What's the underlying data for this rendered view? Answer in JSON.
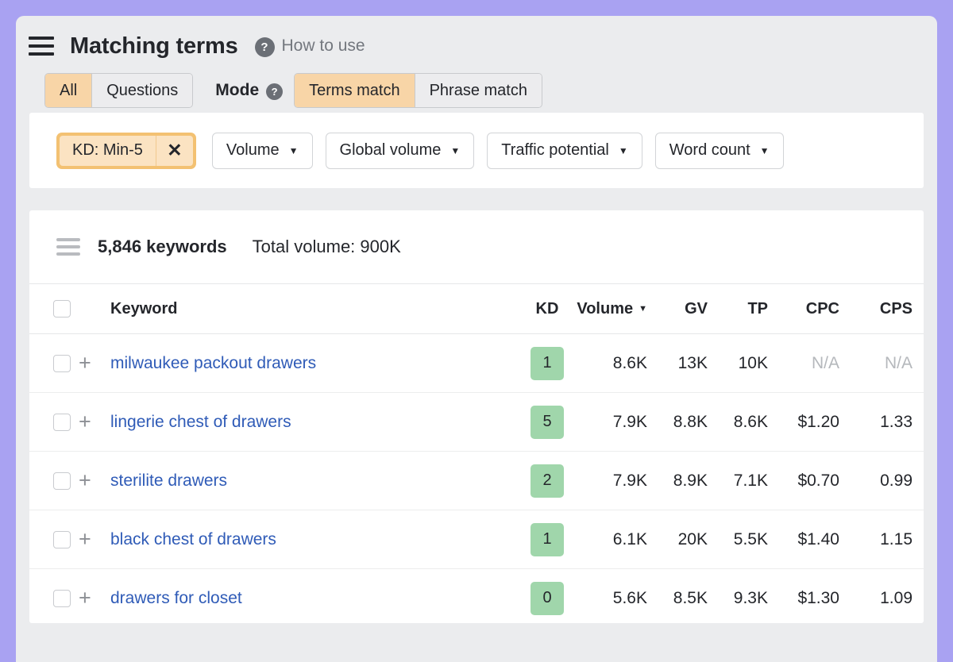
{
  "header": {
    "menu_icon": "hamburger-icon",
    "title": "Matching terms",
    "help_icon": "question-mark-icon",
    "help_label": "How to use"
  },
  "mode_bar": {
    "scope_tabs": [
      {
        "label": "All",
        "active": true
      },
      {
        "label": "Questions",
        "active": false
      }
    ],
    "mode_label": "Mode",
    "mode_help_icon": "question-mark-icon",
    "mode_tabs": [
      {
        "label": "Terms match",
        "active": true
      },
      {
        "label": "Phrase match",
        "active": false
      }
    ]
  },
  "filters": {
    "active_chip": {
      "label": "KD: Min-5",
      "remove_icon": "close-icon"
    },
    "chips": [
      {
        "label": "Volume"
      },
      {
        "label": "Global volume"
      },
      {
        "label": "Traffic potential"
      },
      {
        "label": "Word count"
      }
    ]
  },
  "table": {
    "list_icon": "list-view-icon",
    "keyword_count": "5,846 keywords",
    "total_volume": "Total volume: 900K",
    "columns": {
      "keyword": "Keyword",
      "kd": "KD",
      "volume": "Volume",
      "gv": "GV",
      "tp": "TP",
      "cpc": "CPC",
      "cps": "CPS"
    },
    "sorted_by": "Volume",
    "sort_direction": "desc",
    "rows": [
      {
        "keyword": "milwaukee packout drawers",
        "kd": "1",
        "volume": "8.6K",
        "gv": "13K",
        "tp": "10K",
        "cpc": "N/A",
        "cps": "N/A",
        "cpc_na": true,
        "cps_na": true
      },
      {
        "keyword": "lingerie chest of drawers",
        "kd": "5",
        "volume": "7.9K",
        "gv": "8.8K",
        "tp": "8.6K",
        "cpc": "$1.20",
        "cps": "1.33",
        "cpc_na": false,
        "cps_na": false
      },
      {
        "keyword": "sterilite drawers",
        "kd": "2",
        "volume": "7.9K",
        "gv": "8.9K",
        "tp": "7.1K",
        "cpc": "$0.70",
        "cps": "0.99",
        "cpc_na": false,
        "cps_na": false
      },
      {
        "keyword": "black chest of drawers",
        "kd": "1",
        "volume": "6.1K",
        "gv": "20K",
        "tp": "5.5K",
        "cpc": "$1.40",
        "cps": "1.15",
        "cpc_na": false,
        "cps_na": false
      },
      {
        "keyword": "drawers for closet",
        "kd": "0",
        "volume": "5.6K",
        "gv": "8.5K",
        "tp": "9.3K",
        "cpc": "$1.30",
        "cps": "1.09",
        "cpc_na": false,
        "cps_na": false
      }
    ]
  },
  "colors": {
    "accent_orange": "#f8d5a7",
    "chip_ring": "#f3c172",
    "kd_green": "#a0d6ab",
    "link_blue": "#2f5bb7",
    "page_backdrop": "#a9a2f2"
  }
}
